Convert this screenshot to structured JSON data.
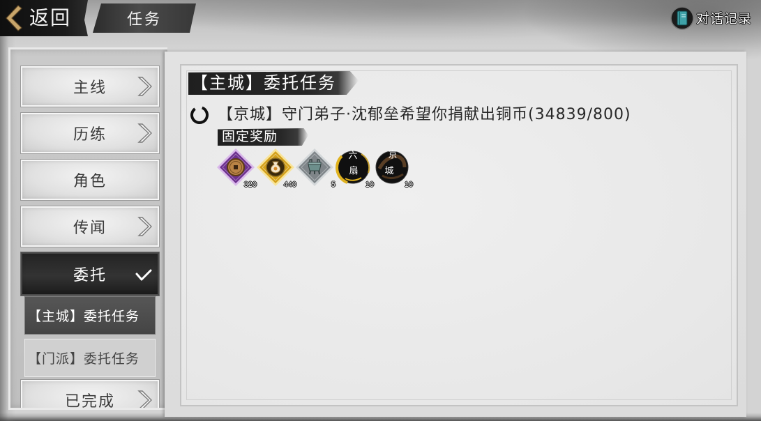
{
  "header": {
    "back_label": "返回",
    "back_icon": "chevron-left-icon",
    "title": "任务",
    "dialog_log_label": "对话记录",
    "dialog_log_icon": "book-icon"
  },
  "sidebar": {
    "arrow_icon": "chevron-right-icon",
    "expanded_icon": "check-icon",
    "categories": [
      {
        "label": "主线",
        "arrow": true,
        "selected": false
      },
      {
        "label": "历练",
        "arrow": true,
        "selected": false
      },
      {
        "label": "角色",
        "arrow": false,
        "selected": false
      },
      {
        "label": "传闻",
        "arrow": true,
        "selected": false
      },
      {
        "label": "委托",
        "arrow": false,
        "selected": true,
        "expanded": true,
        "children": [
          {
            "label": "【主城】委托任务",
            "selected": true
          },
          {
            "label": "【门派】委托任务",
            "selected": false
          }
        ]
      },
      {
        "label": "已完成",
        "arrow": true,
        "selected": false
      }
    ]
  },
  "panel": {
    "title": "【主城】委托任务",
    "quest": {
      "status_icon": "loading-ring-icon",
      "text": "【京城】守门弟子·沈郁垒希望你捐献出铜币(34839/800)"
    },
    "reward_label": "固定奖励",
    "rewards": [
      {
        "icon": "copper-coin-icon",
        "count": "320",
        "frame_color": "#6c2f8e",
        "edge_color": "#d9b8ea"
      },
      {
        "icon": "money-bag-icon",
        "count": "440",
        "frame_color": "#d4a017",
        "edge_color": "#f8e49a"
      },
      {
        "icon": "cauldron-icon",
        "count": "5",
        "frame_color": "#7f8589",
        "edge_color": "#d3d7d9"
      },
      {
        "icon": "liushan-token-icon",
        "count": "10",
        "emblem": [
          "六",
          "扇"
        ]
      },
      {
        "icon": "jingcheng-token-icon",
        "count": "10",
        "emblem": [
          "京",
          "城"
        ]
      }
    ]
  },
  "colors": {
    "back_chevron": "#c9a66b",
    "book_icon": "#3fa2a8",
    "menu_selected_bg": "#242424",
    "submenu_selected_bg": "#4c4c4c",
    "submenu_bg": "#d0d0d0",
    "quest_text": "#272727",
    "brush_label_bg": "#1f1f1f"
  }
}
